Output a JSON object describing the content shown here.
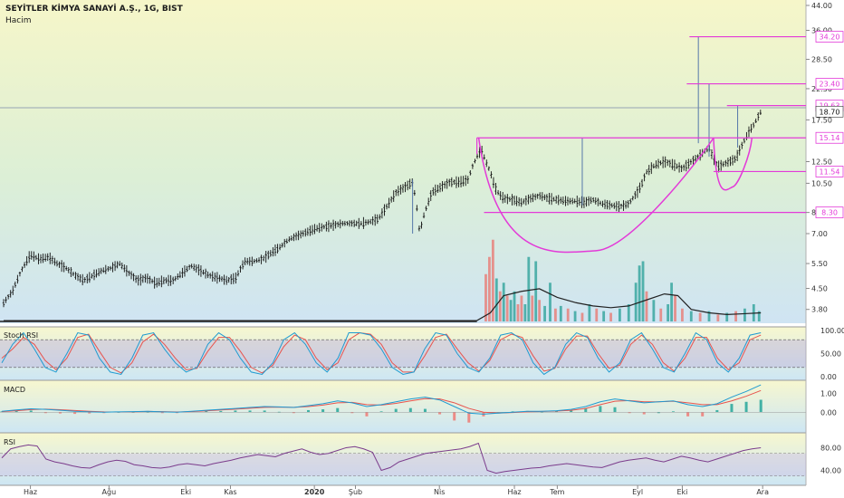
{
  "header": {
    "title": "SEYİTLER KİMYA SANAYİ A.Ş., 1G, BIST",
    "volume_label": "Hacim"
  },
  "panes": {
    "stoch_label": "Stoch RSI",
    "macd_label": "MACD",
    "rsi_label": "RSI"
  },
  "chart_data": [
    {
      "type": "candlestick",
      "scale": "log",
      "ylim": [
        3.5,
        44.0
      ],
      "y_ticks": [
        "44.00",
        "36.00",
        "28.50",
        "22.50",
        "17.50",
        "12.50",
        "10.50",
        "8.30",
        "7.00",
        "5.50",
        "4.50",
        "3.80"
      ],
      "x_ticks": [
        "Haz",
        "Ağu",
        "Eki",
        "Kas",
        "2020",
        "Şub",
        "Nis",
        "Haz",
        "Tem",
        "Eyl",
        "Eki",
        "Ara"
      ],
      "price_line": [
        {
          "t": 0,
          "v": 4.0
        },
        {
          "t": 10,
          "v": 4.4
        },
        {
          "t": 20,
          "v": 5.2
        },
        {
          "t": 30,
          "v": 5.9
        },
        {
          "t": 40,
          "v": 5.7
        },
        {
          "t": 50,
          "v": 5.8
        },
        {
          "t": 60,
          "v": 5.5
        },
        {
          "t": 70,
          "v": 5.3
        },
        {
          "t": 80,
          "v": 5.0
        },
        {
          "t": 90,
          "v": 4.8
        },
        {
          "t": 100,
          "v": 5.0
        },
        {
          "t": 110,
          "v": 5.2
        },
        {
          "t": 120,
          "v": 5.3
        },
        {
          "t": 130,
          "v": 5.5
        },
        {
          "t": 140,
          "v": 5.1
        },
        {
          "t": 150,
          "v": 4.8
        },
        {
          "t": 160,
          "v": 4.9
        },
        {
          "t": 170,
          "v": 4.7
        },
        {
          "t": 180,
          "v": 4.8
        },
        {
          "t": 190,
          "v": 4.8
        },
        {
          "t": 200,
          "v": 5.1
        },
        {
          "t": 210,
          "v": 5.4
        },
        {
          "t": 220,
          "v": 5.2
        },
        {
          "t": 230,
          "v": 5.0
        },
        {
          "t": 240,
          "v": 4.9
        },
        {
          "t": 250,
          "v": 4.8
        },
        {
          "t": 260,
          "v": 4.9
        },
        {
          "t": 270,
          "v": 5.6
        },
        {
          "t": 280,
          "v": 5.6
        },
        {
          "t": 290,
          "v": 5.7
        },
        {
          "t": 300,
          "v": 6.0
        },
        {
          "t": 310,
          "v": 6.3
        },
        {
          "t": 320,
          "v": 6.7
        },
        {
          "t": 330,
          "v": 6.9
        },
        {
          "t": 340,
          "v": 7.1
        },
        {
          "t": 350,
          "v": 7.3
        },
        {
          "t": 360,
          "v": 7.4
        },
        {
          "t": 370,
          "v": 7.5
        },
        {
          "t": 380,
          "v": 7.6
        },
        {
          "t": 390,
          "v": 7.6
        },
        {
          "t": 400,
          "v": 7.6
        },
        {
          "t": 410,
          "v": 7.7
        },
        {
          "t": 420,
          "v": 7.9
        },
        {
          "t": 430,
          "v": 8.8
        },
        {
          "t": 440,
          "v": 9.8
        },
        {
          "t": 450,
          "v": 10.2
        },
        {
          "t": 458,
          "v": 10.6
        },
        {
          "t": 462,
          "v": 9.0
        },
        {
          "t": 466,
          "v": 7.0
        },
        {
          "t": 470,
          "v": 8.0
        },
        {
          "t": 480,
          "v": 9.8
        },
        {
          "t": 490,
          "v": 10.2
        },
        {
          "t": 500,
          "v": 10.6
        },
        {
          "t": 510,
          "v": 10.6
        },
        {
          "t": 520,
          "v": 10.8
        },
        {
          "t": 525,
          "v": 12.0
        },
        {
          "t": 530,
          "v": 13.0
        },
        {
          "t": 535,
          "v": 13.8
        },
        {
          "t": 540,
          "v": 12.5
        },
        {
          "t": 545,
          "v": 11.5
        },
        {
          "t": 550,
          "v": 10.2
        },
        {
          "t": 555,
          "v": 9.6
        },
        {
          "t": 560,
          "v": 9.3
        },
        {
          "t": 570,
          "v": 9.2
        },
        {
          "t": 580,
          "v": 9.0
        },
        {
          "t": 590,
          "v": 9.3
        },
        {
          "t": 600,
          "v": 9.5
        },
        {
          "t": 610,
          "v": 9.3
        },
        {
          "t": 620,
          "v": 9.2
        },
        {
          "t": 630,
          "v": 9.1
        },
        {
          "t": 640,
          "v": 9.1
        },
        {
          "t": 650,
          "v": 9.0
        },
        {
          "t": 660,
          "v": 9.2
        },
        {
          "t": 670,
          "v": 8.9
        },
        {
          "t": 680,
          "v": 8.8
        },
        {
          "t": 690,
          "v": 8.7
        },
        {
          "t": 700,
          "v": 8.9
        },
        {
          "t": 710,
          "v": 9.8
        },
        {
          "t": 715,
          "v": 10.5
        },
        {
          "t": 720,
          "v": 11.5
        },
        {
          "t": 730,
          "v": 12.2
        },
        {
          "t": 740,
          "v": 12.5
        },
        {
          "t": 750,
          "v": 12.2
        },
        {
          "t": 760,
          "v": 11.8
        },
        {
          "t": 770,
          "v": 12.5
        },
        {
          "t": 780,
          "v": 13.2
        },
        {
          "t": 790,
          "v": 14.0
        },
        {
          "t": 795,
          "v": 12.8
        },
        {
          "t": 800,
          "v": 12.0
        },
        {
          "t": 810,
          "v": 12.4
        },
        {
          "t": 820,
          "v": 12.8
        },
        {
          "t": 828,
          "v": 14.5
        },
        {
          "t": 835,
          "v": 16.0
        },
        {
          "t": 840,
          "v": 16.8
        },
        {
          "t": 848,
          "v": 18.7
        }
      ],
      "spikes": [
        {
          "t": 648,
          "hi": 15.14,
          "lo": 8.8
        },
        {
          "t": 778,
          "hi": 34.2,
          "lo": 14.5
        },
        {
          "t": 790,
          "hi": 23.4,
          "lo": 13.0
        },
        {
          "t": 822,
          "hi": 19.63,
          "lo": 14.0
        },
        {
          "t": 458,
          "hi": 10.8,
          "lo": 7.0
        }
      ],
      "levels": [
        {
          "value": 34.2,
          "label": "34.20",
          "t_start": 768
        },
        {
          "value": 23.4,
          "label": "23.40",
          "t_start": 765
        },
        {
          "value": 19.63,
          "label": "19.63",
          "t_start": 810
        },
        {
          "value": 15.14,
          "label": "15.14",
          "t_start": 530
        },
        {
          "value": 11.54,
          "label": "11.54",
          "t_start": 795
        },
        {
          "value": 8.3,
          "label": "8.30",
          "t_start": 538
        }
      ],
      "last_price": 18.7,
      "last_price_label": "18.70",
      "ref_line": 19.3,
      "cup_arcs": [
        {
          "t_from": 532,
          "t_to": 795,
          "top": 15.14,
          "bottom": 6.1
        },
        {
          "t_from": 795,
          "t_to": 838,
          "top": 15.14,
          "bottom": 10.2
        }
      ]
    },
    {
      "type": "bar",
      "name": "Hacim",
      "bars": [
        {
          "t": 540,
          "v": 0.55,
          "c": "r"
        },
        {
          "t": 544,
          "v": 0.75,
          "c": "r"
        },
        {
          "t": 548,
          "v": 0.95,
          "c": "r"
        },
        {
          "t": 552,
          "v": 0.5,
          "c": "g"
        },
        {
          "t": 556,
          "v": 0.35,
          "c": "r"
        },
        {
          "t": 560,
          "v": 0.45,
          "c": "g"
        },
        {
          "t": 564,
          "v": 0.3,
          "c": "r"
        },
        {
          "t": 568,
          "v": 0.25,
          "c": "g"
        },
        {
          "t": 572,
          "v": 0.35,
          "c": "g"
        },
        {
          "t": 576,
          "v": 0.2,
          "c": "r"
        },
        {
          "t": 580,
          "v": 0.3,
          "c": "r"
        },
        {
          "t": 584,
          "v": 0.2,
          "c": "g"
        },
        {
          "t": 588,
          "v": 0.75,
          "c": "g"
        },
        {
          "t": 592,
          "v": 0.3,
          "c": "r"
        },
        {
          "t": 596,
          "v": 0.7,
          "c": "g"
        },
        {
          "t": 600,
          "v": 0.25,
          "c": "r"
        },
        {
          "t": 606,
          "v": 0.18,
          "c": "g"
        },
        {
          "t": 612,
          "v": 0.45,
          "c": "g"
        },
        {
          "t": 618,
          "v": 0.15,
          "c": "r"
        },
        {
          "t": 624,
          "v": 0.18,
          "c": "g"
        },
        {
          "t": 632,
          "v": 0.15,
          "c": "r"
        },
        {
          "t": 640,
          "v": 0.12,
          "c": "g"
        },
        {
          "t": 648,
          "v": 0.1,
          "c": "r"
        },
        {
          "t": 656,
          "v": 0.2,
          "c": "g"
        },
        {
          "t": 664,
          "v": 0.15,
          "c": "r"
        },
        {
          "t": 672,
          "v": 0.12,
          "c": "g"
        },
        {
          "t": 680,
          "v": 0.1,
          "c": "r"
        },
        {
          "t": 690,
          "v": 0.15,
          "c": "g"
        },
        {
          "t": 700,
          "v": 0.2,
          "c": "g"
        },
        {
          "t": 708,
          "v": 0.45,
          "c": "g"
        },
        {
          "t": 712,
          "v": 0.65,
          "c": "g"
        },
        {
          "t": 716,
          "v": 0.7,
          "c": "g"
        },
        {
          "t": 720,
          "v": 0.35,
          "c": "r"
        },
        {
          "t": 728,
          "v": 0.25,
          "c": "g"
        },
        {
          "t": 736,
          "v": 0.15,
          "c": "r"
        },
        {
          "t": 744,
          "v": 0.2,
          "c": "g"
        },
        {
          "t": 748,
          "v": 0.45,
          "c": "g"
        },
        {
          "t": 752,
          "v": 0.3,
          "c": "r"
        },
        {
          "t": 760,
          "v": 0.15,
          "c": "r"
        },
        {
          "t": 770,
          "v": 0.12,
          "c": "g"
        },
        {
          "t": 780,
          "v": 0.1,
          "c": "r"
        },
        {
          "t": 790,
          "v": 0.12,
          "c": "g"
        },
        {
          "t": 800,
          "v": 0.08,
          "c": "r"
        },
        {
          "t": 810,
          "v": 0.1,
          "c": "g"
        },
        {
          "t": 820,
          "v": 0.12,
          "c": "r"
        },
        {
          "t": 830,
          "v": 0.15,
          "c": "g"
        },
        {
          "t": 840,
          "v": 0.2,
          "c": "g"
        },
        {
          "t": 846,
          "v": 0.12,
          "c": "g"
        }
      ],
      "ma": [
        {
          "t": 0,
          "v": 0.01
        },
        {
          "t": 530,
          "v": 0.01
        },
        {
          "t": 545,
          "v": 0.1
        },
        {
          "t": 560,
          "v": 0.3
        },
        {
          "t": 580,
          "v": 0.35
        },
        {
          "t": 600,
          "v": 0.38
        },
        {
          "t": 620,
          "v": 0.28
        },
        {
          "t": 640,
          "v": 0.22
        },
        {
          "t": 660,
          "v": 0.18
        },
        {
          "t": 680,
          "v": 0.16
        },
        {
          "t": 700,
          "v": 0.18
        },
        {
          "t": 720,
          "v": 0.25
        },
        {
          "t": 740,
          "v": 0.32
        },
        {
          "t": 755,
          "v": 0.3
        },
        {
          "t": 770,
          "v": 0.14
        },
        {
          "t": 790,
          "v": 0.1
        },
        {
          "t": 810,
          "v": 0.08
        },
        {
          "t": 830,
          "v": 0.09
        },
        {
          "t": 848,
          "v": 0.1
        }
      ]
    },
    {
      "type": "line",
      "name": "Stoch RSI",
      "ylim": [
        0,
        100
      ],
      "y_ticks": [
        "100.00",
        "50.00",
        "0.00"
      ],
      "bands": [
        80,
        20
      ],
      "series": [
        {
          "key": "k",
          "values": [
            30,
            70,
            95,
            60,
            20,
            10,
            50,
            95,
            90,
            40,
            10,
            5,
            40,
            90,
            95,
            60,
            30,
            10,
            20,
            70,
            95,
            80,
            40,
            10,
            5,
            30,
            80,
            95,
            70,
            30,
            10,
            40,
            95,
            95,
            90,
            60,
            20,
            5,
            10,
            60,
            95,
            90,
            50,
            20,
            10,
            40,
            90,
            95,
            80,
            30,
            5,
            20,
            70,
            95,
            85,
            40,
            10,
            30,
            80,
            95,
            60,
            20,
            10,
            50,
            95,
            80,
            30,
            10,
            40,
            90,
            95
          ]
        },
        {
          "key": "d",
          "values": [
            40,
            60,
            85,
            70,
            35,
            15,
            40,
            85,
            92,
            55,
            20,
            8,
            30,
            75,
            92,
            70,
            40,
            15,
            18,
            55,
            85,
            85,
            55,
            20,
            8,
            25,
            65,
            90,
            80,
            40,
            15,
            30,
            80,
            95,
            92,
            70,
            30,
            10,
            10,
            45,
            85,
            92,
            60,
            30,
            12,
            35,
            80,
            92,
            85,
            45,
            12,
            18,
            60,
            88,
            88,
            50,
            18,
            25,
            70,
            90,
            70,
            30,
            12,
            40,
            85,
            85,
            40,
            15,
            30,
            80,
            90
          ]
        }
      ]
    },
    {
      "type": "line",
      "name": "MACD",
      "ylim": [
        -0.9,
        1.5
      ],
      "y_ticks": [
        "1.00",
        "0.00"
      ],
      "series": [
        {
          "key": "macd",
          "values": [
            0.05,
            0.12,
            0.18,
            0.15,
            0.1,
            0.05,
            0.02,
            0.0,
            0.02,
            0.03,
            0.05,
            0.02,
            0.0,
            0.05,
            0.1,
            0.15,
            0.2,
            0.25,
            0.3,
            0.28,
            0.25,
            0.35,
            0.45,
            0.6,
            0.5,
            0.3,
            0.4,
            0.55,
            0.7,
            0.8,
            0.65,
            0.3,
            -0.05,
            -0.1,
            -0.05,
            0.0,
            0.05,
            0.05,
            0.08,
            0.15,
            0.3,
            0.55,
            0.7,
            0.6,
            0.5,
            0.55,
            0.6,
            0.4,
            0.3,
            0.45,
            0.8,
            1.1,
            1.45
          ]
        },
        {
          "key": "signal",
          "values": [
            0.03,
            0.08,
            0.14,
            0.16,
            0.13,
            0.09,
            0.05,
            0.02,
            0.01,
            0.02,
            0.04,
            0.03,
            0.01,
            0.03,
            0.07,
            0.12,
            0.16,
            0.21,
            0.26,
            0.27,
            0.26,
            0.3,
            0.38,
            0.5,
            0.52,
            0.4,
            0.38,
            0.47,
            0.6,
            0.72,
            0.7,
            0.5,
            0.2,
            0.0,
            -0.05,
            -0.02,
            0.02,
            0.04,
            0.06,
            0.1,
            0.2,
            0.4,
            0.58,
            0.62,
            0.55,
            0.55,
            0.58,
            0.5,
            0.4,
            0.4,
            0.6,
            0.85,
            1.15
          ]
        }
      ]
    },
    {
      "type": "line",
      "name": "RSI",
      "ylim": [
        20,
        100
      ],
      "y_ticks": [
        "80.00",
        "40.00"
      ],
      "bands": [
        70,
        30
      ],
      "values": [
        62,
        78,
        82,
        85,
        83,
        60,
        55,
        52,
        48,
        45,
        44,
        50,
        55,
        58,
        56,
        50,
        48,
        45,
        44,
        46,
        50,
        52,
        50,
        48,
        52,
        55,
        58,
        62,
        65,
        68,
        66,
        64,
        70,
        74,
        78,
        72,
        68,
        70,
        75,
        80,
        82,
        78,
        72,
        40,
        45,
        55,
        60,
        65,
        70,
        72,
        74,
        76,
        78,
        82,
        88,
        40,
        35,
        38,
        40,
        42,
        44,
        45,
        48,
        50,
        52,
        50,
        48,
        46,
        45,
        50,
        55,
        58,
        60,
        62,
        58,
        55,
        60,
        65,
        62,
        58,
        55,
        60,
        65,
        70,
        75,
        78,
        80
      ]
    }
  ]
}
